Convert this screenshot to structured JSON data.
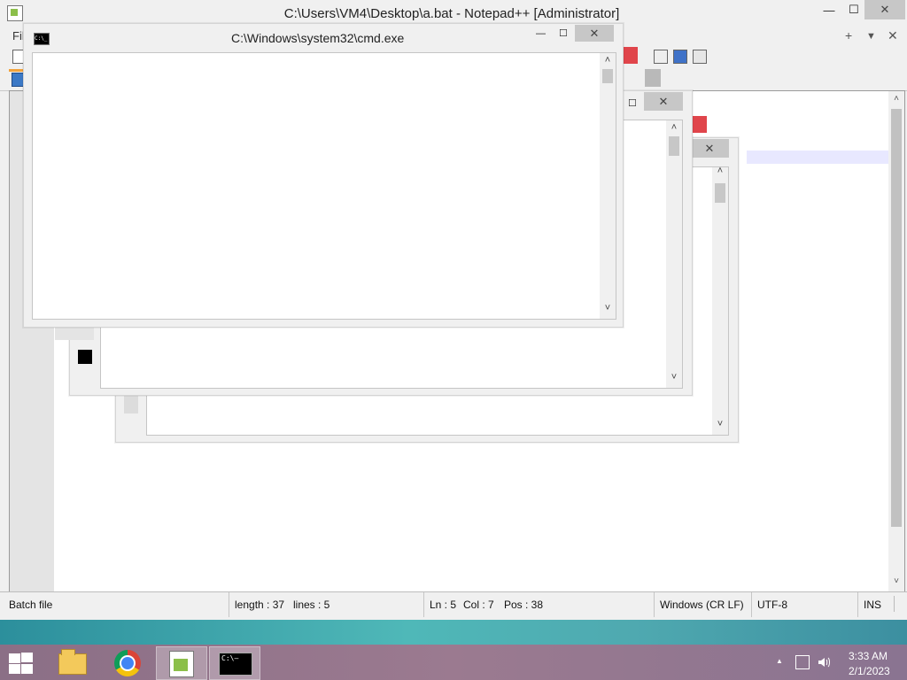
{
  "notepad": {
    "title": "C:\\Users\\VM4\\Desktop\\a.bat - Notepad++ [Administrator]",
    "menu_file": "Fil",
    "menu_right": {
      "plus": "+",
      "dropdown": "▼",
      "close": "✕"
    },
    "caption": {
      "minimize": "—",
      "maximize": "☐",
      "close": "✕"
    },
    "status": {
      "file_type": "Batch file",
      "length": "length : 37",
      "lines": "lines : 5",
      "ln": "Ln : 5",
      "col": "Col : 7",
      "pos": "Pos : 38",
      "eol": "Windows (CR LF)",
      "encoding": "UTF-8",
      "mode": "INS"
    }
  },
  "cmd_windows": [
    {
      "title": "C:\\Windows\\system32\\cmd.exe",
      "minimize": "—",
      "maximize": "☐",
      "close": "✕"
    },
    {
      "maximize": "☐",
      "close": "✕"
    },
    {
      "close": "✕"
    }
  ],
  "cmd_icon_text": "C:\\_",
  "scroll_arrows": {
    "up": "˄",
    "down": "˅"
  },
  "taskbar": {
    "apps": [
      "Start",
      "File Explorer",
      "Google Chrome",
      "Notepad++",
      "Command Prompt"
    ],
    "cmd_icon_text": "C:\\—",
    "tray_chevron": "▲",
    "clock_time": "3:33 AM",
    "clock_date": "2/1/2023"
  },
  "colors": {
    "accent_red": "#e0454b",
    "taskbar": "#8b6f86",
    "desktop": "#3aa0a8"
  }
}
